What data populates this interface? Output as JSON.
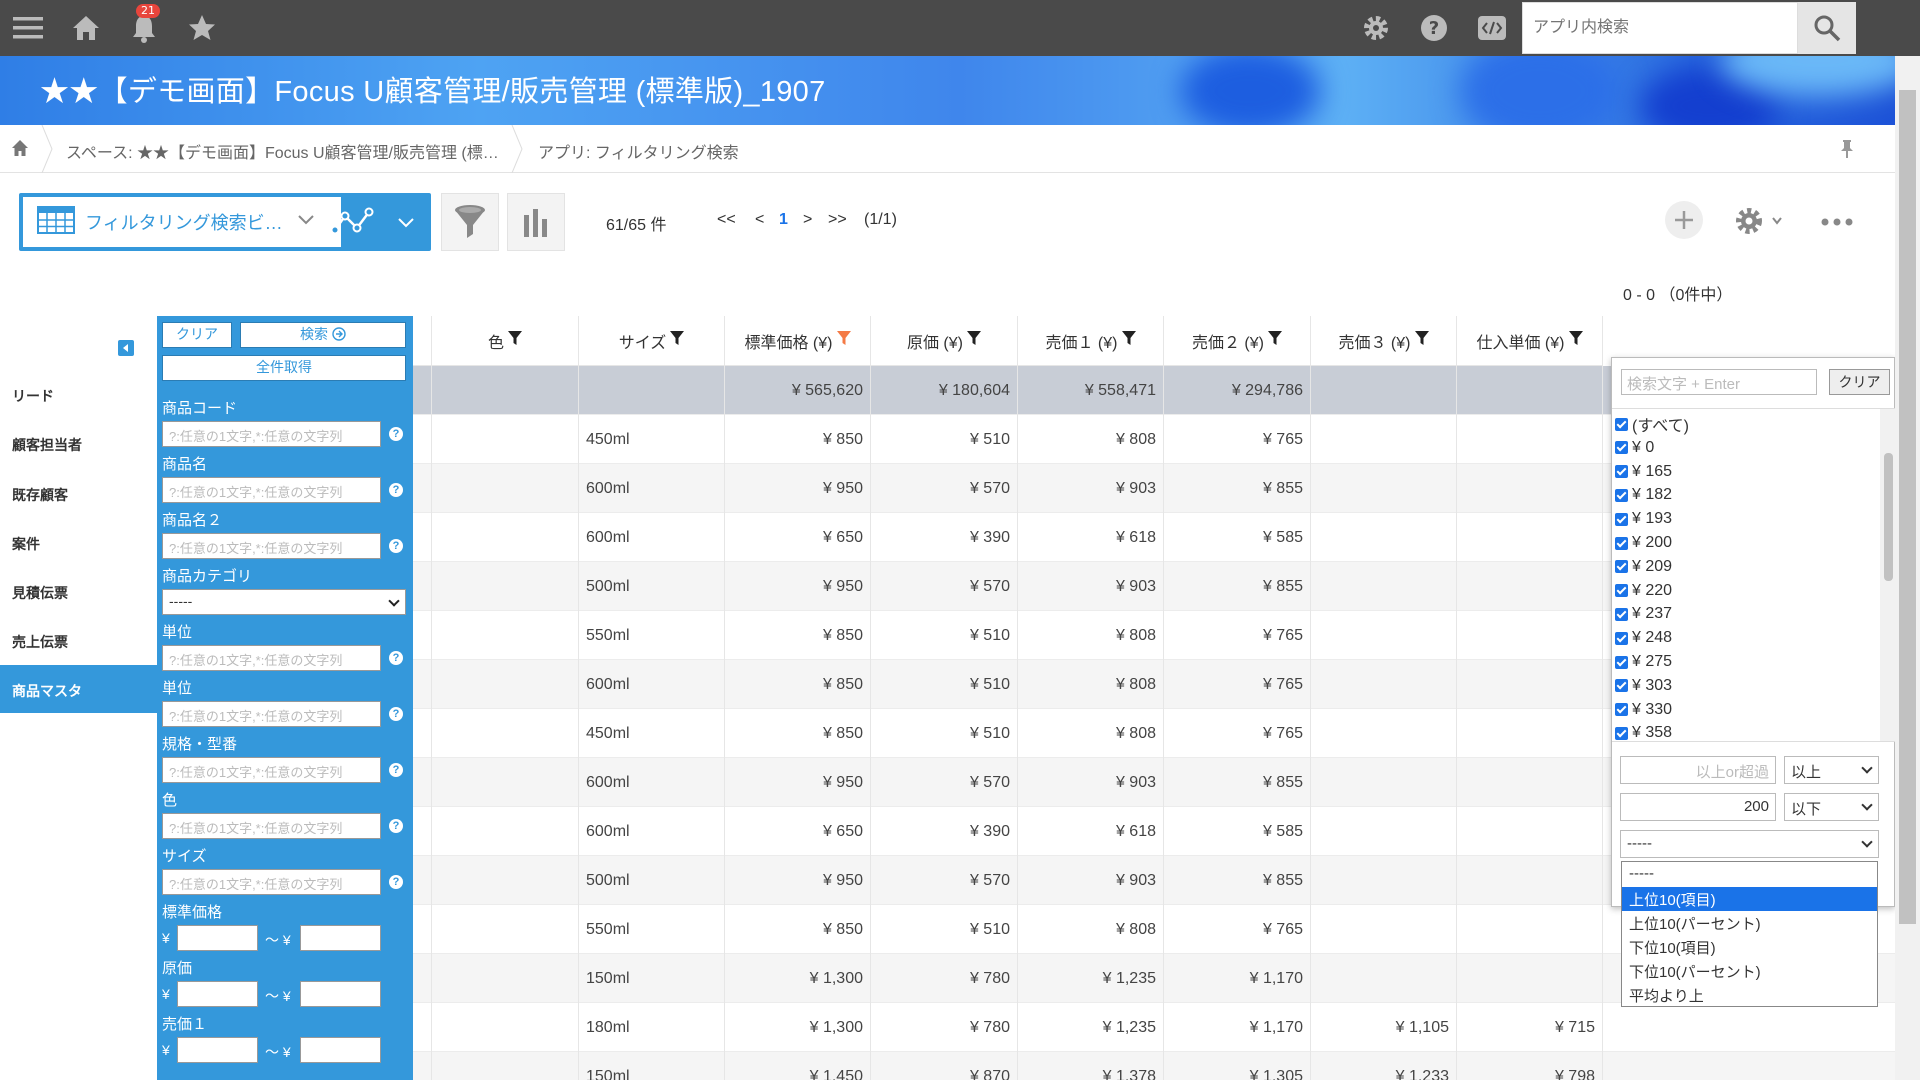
{
  "topbar": {
    "notification_count": "21",
    "search_placeholder": "アプリ内検索"
  },
  "banner": {
    "title": "★★【デモ画面】Focus U顧客管理/販売管理 (標準版)_1907"
  },
  "breadcrumb": {
    "space": "スペース: ★★【デモ画面】Focus U顧客管理/販売管理 (標…",
    "app": "アプリ: フィルタリング検索"
  },
  "toolbar": {
    "view_name": "フィルタリング検索ビ…",
    "record_count": "61/65 件",
    "pager_first": "<<",
    "pager_prev": "<",
    "pager_current": "1",
    "pager_next": ">",
    "pager_last": ">>",
    "pager_total": "(1/1)",
    "range": "0 - 0 （0件中）"
  },
  "nav": {
    "items": [
      {
        "label": "リード"
      },
      {
        "label": "顧客担当者"
      },
      {
        "label": "既存顧客"
      },
      {
        "label": "案件"
      },
      {
        "label": "見積伝票"
      },
      {
        "label": "売上伝票"
      },
      {
        "label": "商品マスタ"
      }
    ]
  },
  "filter": {
    "clear_label": "クリア",
    "search_label": "検索",
    "all_label": "全件取得",
    "placeholder": "?:任意の1文字,*:任意の文字列",
    "fields": [
      {
        "label": "商品コード"
      },
      {
        "label": "商品名"
      },
      {
        "label": "商品名２"
      },
      {
        "label": "商品カテゴリ"
      },
      {
        "label": "単位"
      },
      {
        "label": "単位"
      },
      {
        "label": "規格・型番"
      },
      {
        "label": "色"
      },
      {
        "label": "サイズ"
      },
      {
        "label": "標準価格"
      },
      {
        "label": "原価"
      },
      {
        "label": "売価１"
      }
    ],
    "category_value": "-----",
    "yen": "¥",
    "tilde": "～ ¥"
  },
  "grid": {
    "headers": [
      "色",
      "サイズ",
      "標準価格 (¥)",
      "原価 (¥)",
      "売価１ (¥)",
      "売価２ (¥)",
      "売価３ (¥)",
      "仕入単価 (¥)"
    ],
    "totals": [
      "",
      "",
      "¥ 565,620",
      "¥ 180,604",
      "¥ 558,471",
      "¥ 294,786",
      "",
      ""
    ],
    "rows": [
      [
        "",
        "450ml",
        "¥ 850",
        "¥ 510",
        "¥ 808",
        "¥ 765",
        "",
        ""
      ],
      [
        "",
        "600ml",
        "¥ 950",
        "¥ 570",
        "¥ 903",
        "¥ 855",
        "",
        ""
      ],
      [
        "",
        "600ml",
        "¥ 650",
        "¥ 390",
        "¥ 618",
        "¥ 585",
        "",
        ""
      ],
      [
        "",
        "500ml",
        "¥ 950",
        "¥ 570",
        "¥ 903",
        "¥ 855",
        "",
        ""
      ],
      [
        "",
        "550ml",
        "¥ 850",
        "¥ 510",
        "¥ 808",
        "¥ 765",
        "",
        ""
      ],
      [
        "",
        "600ml",
        "¥ 850",
        "¥ 510",
        "¥ 808",
        "¥ 765",
        "",
        ""
      ],
      [
        "",
        "450ml",
        "¥ 850",
        "¥ 510",
        "¥ 808",
        "¥ 765",
        "",
        ""
      ],
      [
        "",
        "600ml",
        "¥ 950",
        "¥ 570",
        "¥ 903",
        "¥ 855",
        "",
        ""
      ],
      [
        "",
        "600ml",
        "¥ 650",
        "¥ 390",
        "¥ 618",
        "¥ 585",
        "",
        ""
      ],
      [
        "",
        "500ml",
        "¥ 950",
        "¥ 570",
        "¥ 903",
        "¥ 855",
        "",
        ""
      ],
      [
        "",
        "550ml",
        "¥ 850",
        "¥ 510",
        "¥ 808",
        "¥ 765",
        "",
        ""
      ],
      [
        "",
        "150ml",
        "¥ 1,300",
        "¥ 780",
        "¥ 1,235",
        "¥ 1,170",
        "",
        ""
      ],
      [
        "",
        "180ml",
        "¥ 1,300",
        "¥ 780",
        "¥ 1,235",
        "¥ 1,170",
        "¥ 1,105",
        "¥ 715"
      ],
      [
        "",
        "150ml",
        "¥ 1,450",
        "¥ 870",
        "¥ 1,378",
        "¥ 1,305",
        "¥ 1,233",
        "¥ 798"
      ]
    ]
  },
  "column_filter": {
    "search_placeholder": "検索文字 + Enter",
    "clear_label": "クリア",
    "values": [
      "(すべて)",
      "¥ 0",
      "¥ 165",
      "¥ 182",
      "¥ 193",
      "¥ 200",
      "¥ 209",
      "¥ 220",
      "¥ 237",
      "¥ 248",
      "¥ 275",
      "¥ 303",
      "¥ 330",
      "¥ 358"
    ],
    "min_placeholder": "以上or超過",
    "min_op": "以上",
    "max_value": "200",
    "max_op": "以下",
    "top_value": "-----",
    "top_options": [
      "-----",
      "上位10(項目)",
      "上位10(パーセント)",
      "下位10(項目)",
      "下位10(パーセント)",
      "平均より上"
    ],
    "top_selected_index": 1
  },
  "colors": {
    "accent": "#3498db",
    "topbar": "#4a4a4a",
    "active_filter": "#f47a45",
    "badge": "#e8453c"
  }
}
